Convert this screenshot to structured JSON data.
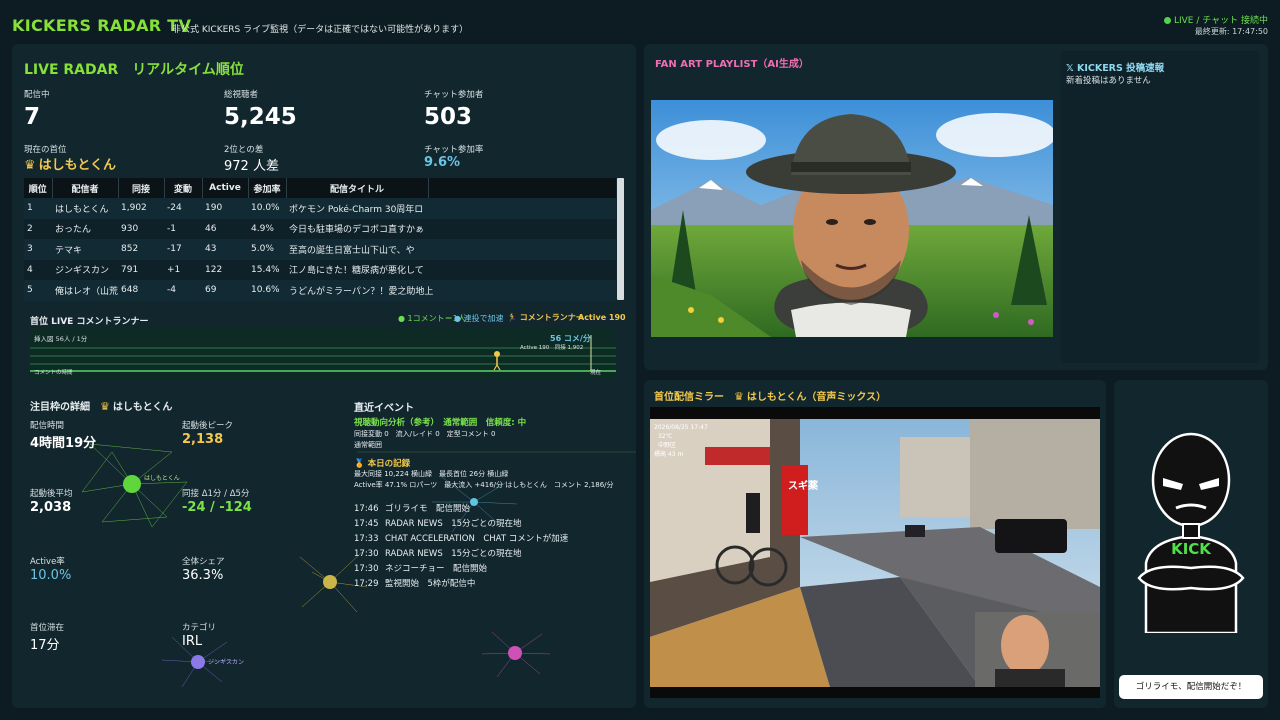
{
  "header": {
    "title": "KICKERS RADAR TV",
    "subtitle": "非公式 KICKERS ライブ監視（データは正確ではない可能性があります）",
    "live_status": "LIVE / チャット 接続中",
    "last_update": "最終更新: 17:47:50"
  },
  "radar": {
    "title": "LIVE RADAR　リアルタイム順位",
    "streaming_label": "配信中",
    "streaming_value": "7",
    "viewers_label": "総視聴者",
    "viewers_value": "5,245",
    "chatters_label": "チャット参加者",
    "chatters_value": "503",
    "leader_label": "現在の首位",
    "leader_name": "はしもとくん",
    "gap_label": "2位との差",
    "gap_value": "972 人差",
    "chat_rate_label": "チャット参加率",
    "chat_rate_value": "9.6%"
  },
  "table": {
    "headers": [
      "順位",
      "配信者",
      "同接",
      "変動",
      "Active",
      "参加率",
      "配信タイトル"
    ],
    "rows": [
      [
        "1",
        "はしもとくん",
        "1,902",
        "-24",
        "190",
        "10.0%",
        "ポケモン Poké-Charm 30周年ロ"
      ],
      [
        "2",
        "おったん",
        "930",
        "-1",
        "46",
        "4.9%",
        "今日も駐車場のデコボコ直すかぁ"
      ],
      [
        "3",
        "テマキ",
        "852",
        "-17",
        "43",
        "5.0%",
        "至高の誕生日富士山下山で、や"
      ],
      [
        "4",
        "ジンギスカン",
        "791",
        "+1",
        "122",
        "15.4%",
        "江ノ島にきた！糖尿病が悪化して"
      ],
      [
        "5",
        "俺はレオ（山荒",
        "648",
        "-4",
        "69",
        "10.6%",
        "うどんがミラーパン？！愛之助地上"
      ]
    ]
  },
  "runner": {
    "title": "首位 LIVE コメントランナー",
    "legend_green": "1コメント＝1人",
    "legend_blue": "連投で加速",
    "legend_runner": "コメントランナー",
    "legend_active": "Active 190",
    "rate": "56 コメ/分",
    "rate_sub": "Active 190　同接 1,902",
    "left_label": "挿入図 56人 / 1分",
    "bottom_left": "コメントの時間",
    "bottom_right": "現在"
  },
  "detail": {
    "title": "注目枠の詳細",
    "name": "はしもとくん",
    "duration_label": "配信時間",
    "duration_value": "4時間19分",
    "peak_label": "起動後ピーク",
    "peak_value": "2,138",
    "avg_label": "起動後平均",
    "avg_value": "2,038",
    "delta_label": "同接 Δ1分 / Δ5分",
    "delta_value": "-24 / -124",
    "active_label": "Active率",
    "active_value": "10.0%",
    "share_label": "全体シェア",
    "share_value": "36.3%",
    "top_label": "首位滞在",
    "top_value": "17分",
    "category_label": "カテゴリ",
    "category_value": "IRL",
    "cluster_label_1": "はしもとくん",
    "cluster_label_2": "ジンギスカン"
  },
  "events": {
    "title": "直近イベント",
    "analysis_line": "視聴動向分析（参考）　通常範囲　信頼度: 中",
    "stats_line1": "同接変動 0　流入/レイド 0　定型コメント 0",
    "stats_line2": "通常範囲",
    "record_title": "本日の記録",
    "record_line1": "最大同接 10,224 横山緑　最長首位 26分 横山緑",
    "record_line2": "Active率 47.1% ロパーツ　最大流入 +416/分 はしもとくん　コメント 2,186/分",
    "items": [
      {
        "time": "17:46",
        "text": "ゴリライモ　配信開始"
      },
      {
        "time": "17:45",
        "text": "RADAR NEWS　15分ごとの現在地"
      },
      {
        "time": "17:33",
        "text": "CHAT ACCELERATION　CHAT コメントが加速"
      },
      {
        "time": "17:30",
        "text": "RADAR NEWS　15分ごとの現在地"
      },
      {
        "time": "17:30",
        "text": "ネジコーチョー　配信開始"
      },
      {
        "time": "17:29",
        "text": "監視開始　5枠が配信中"
      }
    ]
  },
  "fanart": {
    "title": "FAN ART PLAYLIST（AI生成）"
  },
  "x_feed": {
    "title": "𝕏 KICKERS 投稿速報",
    "empty": "新着投稿はありません"
  },
  "mirror": {
    "title": "首位配信ミラー",
    "name": "はしもとくん（音声ミックス）",
    "overlay_date": "2026/08/25 17:47",
    "overlay_temp": "32℃",
    "overlay_place": "中野区",
    "overlay_alt": "標高 43 m",
    "sign_text": "スギ薬"
  },
  "mascot": {
    "shirt_text": "KICK",
    "bubble": "ゴリライモ、配信開始だぞ！"
  },
  "colors": {
    "accent_green": "#86e03a",
    "gold": "#f2c94c",
    "blue": "#6cc4e4",
    "pink": "#ee6fb2"
  }
}
